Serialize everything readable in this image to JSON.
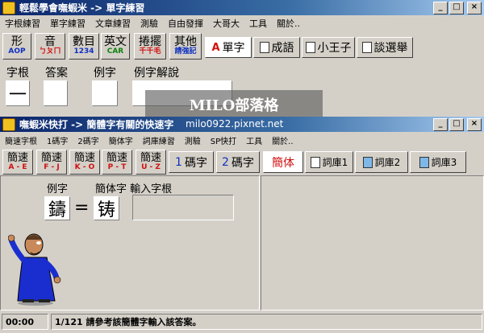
{
  "top_window": {
    "title": "輕鬆學會嘸蝦米 -> 單字練習",
    "menu": [
      "字根練習",
      "單字練習",
      "文章練習",
      "測驗",
      "自由發揮",
      "大哥大",
      "工具",
      "關於.."
    ],
    "tool_buttons": [
      {
        "main": "形",
        "sub": "AOP",
        "color": "#1030c0"
      },
      {
        "main": "音",
        "sub": "ㄅㄆㄇ",
        "color": "#d01010"
      },
      {
        "main": "數目",
        "sub": "1234",
        "color": "#1030c0"
      },
      {
        "main": "英文",
        "sub": "CAR",
        "color": "#108010"
      },
      {
        "main": "捲擺",
        "sub": "千千毛",
        "color": "#d01010"
      },
      {
        "main": "其他",
        "sub": "請強記",
        "color": "#1030c0"
      }
    ],
    "tabs": [
      "單字",
      "成語",
      "小王子",
      "談選舉"
    ],
    "labels": {
      "root": "字根",
      "answer": "答案",
      "example": "例字",
      "explain": "例字解說"
    },
    "root_char": "一"
  },
  "watermark": {
    "title": "MILO部落格",
    "url": "milo0922.pixnet.net"
  },
  "bottom_window": {
    "title": "嘸蝦米快打 -> 簡體字有關的快速字",
    "menu": [
      "簡速字根",
      "1碼字",
      "2碼字",
      "簡体字",
      "詞庫練習",
      "測驗",
      "SP快打",
      "工具",
      "關於.."
    ],
    "quick_buttons": [
      {
        "main": "簡速",
        "sub": "A - E"
      },
      {
        "main": "簡速",
        "sub": "F - J"
      },
      {
        "main": "簡速",
        "sub": "K - O"
      },
      {
        "main": "簡速",
        "sub": "P - T"
      },
      {
        "main": "簡速",
        "sub": "U - Z"
      }
    ],
    "code_buttons": [
      {
        "num": "1",
        "label": "碼字"
      },
      {
        "num": "2",
        "label": "碼字"
      }
    ],
    "tabs": [
      "簡体",
      "詞庫1",
      "詞庫2",
      "詞庫3"
    ],
    "labels": {
      "example": "例字",
      "simplified_prompt": "簡体字 輸入字根"
    },
    "trad_char": "鑄",
    "equals": "=",
    "simp_char": "铸",
    "status_time": "00:00",
    "status_msg": "1/121 請參考該簡體字輸入該答案。"
  },
  "colors": {
    "accent_red": "#d01010",
    "accent_blue": "#1030c0",
    "robe_blue": "#1a2ed0"
  }
}
